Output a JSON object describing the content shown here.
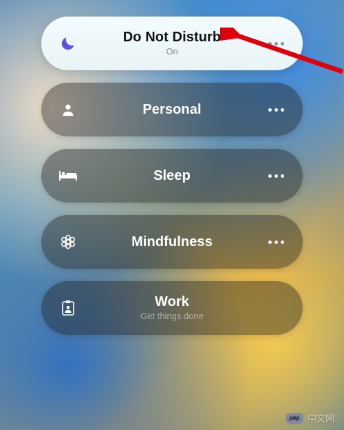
{
  "focus_modes": [
    {
      "id": "dnd",
      "label": "Do Not Disturb",
      "sub": "On",
      "icon": "moon",
      "active": true,
      "has_more": true
    },
    {
      "id": "personal",
      "label": "Personal",
      "sub": "",
      "icon": "person",
      "active": false,
      "has_more": true
    },
    {
      "id": "sleep",
      "label": "Sleep",
      "sub": "",
      "icon": "bed",
      "active": false,
      "has_more": true
    },
    {
      "id": "mindfulness",
      "label": "Mindfulness",
      "sub": "",
      "icon": "flower",
      "active": false,
      "has_more": true
    },
    {
      "id": "work",
      "label": "Work",
      "sub": "Get things done",
      "icon": "badge",
      "active": false,
      "has_more": false
    }
  ],
  "annotation": {
    "arrow_target": "dnd"
  },
  "watermark": {
    "text": "中文网",
    "brand": "php"
  },
  "colors": {
    "active_icon": "#5856d6",
    "inactive_icon": "#ffffff"
  }
}
